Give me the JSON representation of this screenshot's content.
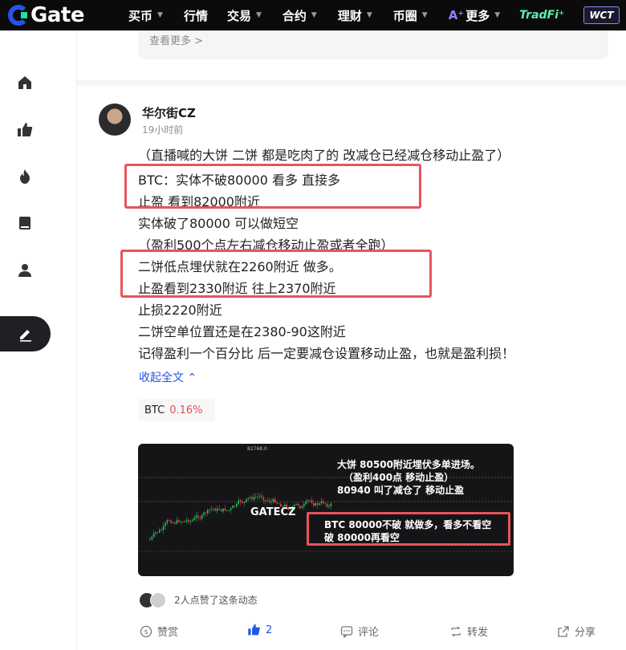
{
  "nav": {
    "logo": "Gate",
    "items": [
      {
        "label": "买币",
        "caret": true
      },
      {
        "label": "行情",
        "caret": false
      },
      {
        "label": "交易",
        "caret": true
      },
      {
        "label": "合约",
        "caret": true
      },
      {
        "label": "理财",
        "caret": true
      },
      {
        "label": "币圈",
        "caret": true
      }
    ],
    "ai_badge": "A⁺",
    "more": "更多",
    "tradfi": "TradFi⁺",
    "wct": "WCT"
  },
  "sidebar": {
    "icons": [
      "home-icon",
      "thumbs-up-icon",
      "fire-icon",
      "book-icon",
      "user-icon",
      "compose-icon"
    ]
  },
  "previous": {
    "see_more": "查看更多 >"
  },
  "post": {
    "author": "华尔街CZ",
    "time": "19小时前",
    "lines": [
      "（直播喊的大饼 二饼 都是吃肉了的 改减仓已经减仓移动止盈了）",
      "BTC：实体不破80000 看多 直接多",
      "止盈 看到82000附近",
      "实体破了80000 可以做短空",
      "（盈利500个点左右减仓移动止盈或者全跑）",
      "二饼低点埋伏就在2260附近 做多。",
      "止盈看到2330附近 往上2370附近",
      "止损2220附近",
      "二饼空单位置还是在2380-90这附近",
      "记得盈利一个百分比 后一定要减仓设置移动止盈，也就是盈利损！"
    ],
    "collapse": "收起全文",
    "ticker": {
      "symbol": "BTC",
      "change": "0.16%"
    },
    "image": {
      "watermark": "GATECZ",
      "price_tag": "82768.0",
      "note1": [
        "大饼  80500附近埋伏多单进场。",
        "（盈利400点 移动止盈）",
        "80940 叫了减仓了 移动止盈"
      ],
      "note2": [
        "BTC 80000不破  就做多，看多不看空",
        "破 80000再看空"
      ]
    },
    "likes_text": "2人点赞了这条动态",
    "actions": {
      "tip": "赞赏",
      "like_count": "2",
      "comment": "评论",
      "repost": "转发",
      "share": "分享"
    }
  },
  "colors": {
    "accent": "#2354e6",
    "highlight": "#e8545a",
    "up": "#e84b4b",
    "chart_green": "#22c55e"
  }
}
